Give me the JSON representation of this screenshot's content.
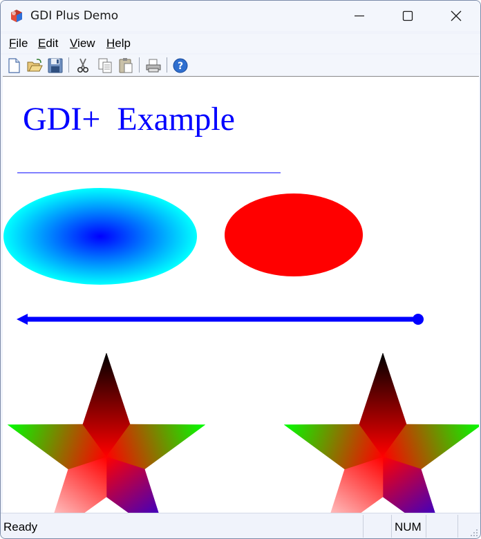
{
  "window": {
    "title": "GDI Plus Demo"
  },
  "menu": {
    "items": [
      {
        "accel": "F",
        "rest": "ile"
      },
      {
        "accel": "E",
        "rest": "dit"
      },
      {
        "accel": "V",
        "rest": "iew"
      },
      {
        "accel": "H",
        "rest": "elp"
      }
    ]
  },
  "toolbar": {
    "buttons": [
      "new-icon",
      "open-icon",
      "save-icon",
      "cut-icon",
      "copy-icon",
      "paste-icon",
      "print-icon",
      "help-icon"
    ]
  },
  "canvas": {
    "heading": "GDI+  Example",
    "text_color": "#0000ff",
    "ellipse_gradient_center": "#0000ff",
    "ellipse_gradient_edge": "#00ffff",
    "solid_ellipse_color": "#ff0000",
    "star_center_color": "#ff0000",
    "star_point_colors": [
      "#000000",
      "#00ff00",
      "#0000ff",
      "#ffffff",
      "#00ff00"
    ]
  },
  "status": {
    "text": "Ready",
    "num": "NUM"
  }
}
